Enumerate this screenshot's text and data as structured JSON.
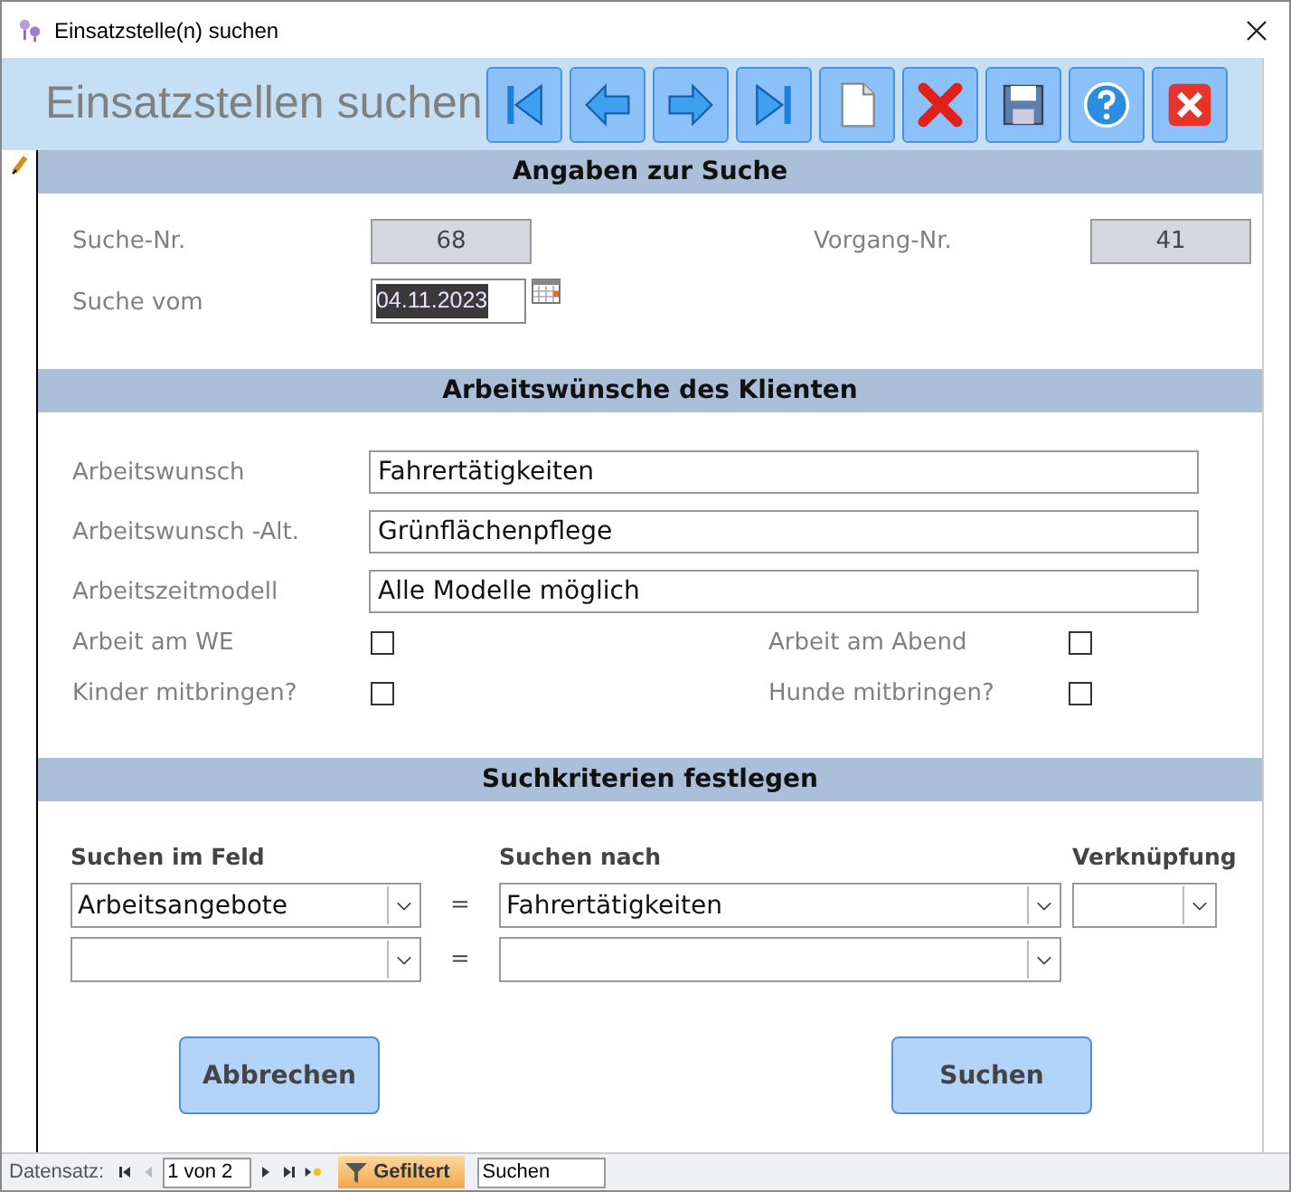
{
  "window": {
    "title": "Einsatzstelle(n) suchen"
  },
  "header": {
    "title": "Einsatzstellen suchen"
  },
  "toolbar": [
    {
      "kind": "first"
    },
    {
      "kind": "prev"
    },
    {
      "kind": "next"
    },
    {
      "kind": "last"
    },
    {
      "kind": "new"
    },
    {
      "kind": "delete"
    },
    {
      "kind": "save"
    },
    {
      "kind": "help"
    },
    {
      "kind": "close"
    }
  ],
  "search_info": {
    "heading": "Angaben zur Suche",
    "search_no_label": "Suche-Nr.",
    "search_no": "68",
    "process_no_label": "Vorgang-Nr.",
    "process_no": "41",
    "date_label": "Suche vom",
    "date": "04.11.2023"
  },
  "wishes": {
    "heading": "Arbeitswünsche des Klienten",
    "fields": [
      {
        "label": "Arbeitswunsch",
        "value": "Fahrertätigkeiten"
      },
      {
        "label": "Arbeitswunsch -Alt.",
        "value": "Grünflächenpflege"
      },
      {
        "label": "Arbeitszeitmodell",
        "value": "Alle Modelle möglich"
      }
    ],
    "checks": [
      {
        "label": "Arbeit am WE",
        "checked": false
      },
      {
        "label": "Arbeit am Abend",
        "checked": false
      },
      {
        "label": "Kinder mitbringen?",
        "checked": false
      },
      {
        "label": "Hunde mitbringen?",
        "checked": false
      }
    ]
  },
  "criteria": {
    "heading": "Suchkriterien festlegen",
    "col_field": "Suchen im Feld",
    "col_value": "Suchen nach",
    "col_link": "Verknüpfung",
    "rows": [
      {
        "field": "Arbeitsangebote",
        "op": "=",
        "value": "Fahrertätigkeiten"
      },
      {
        "field": "",
        "op": "=",
        "value": ""
      }
    ]
  },
  "buttons": [
    "Abbrechen",
    "Suchen"
  ],
  "status_bar": {
    "label": "Datensatz:",
    "position": "1 von 2",
    "filter": "Gefiltert",
    "search": "Suchen"
  }
}
